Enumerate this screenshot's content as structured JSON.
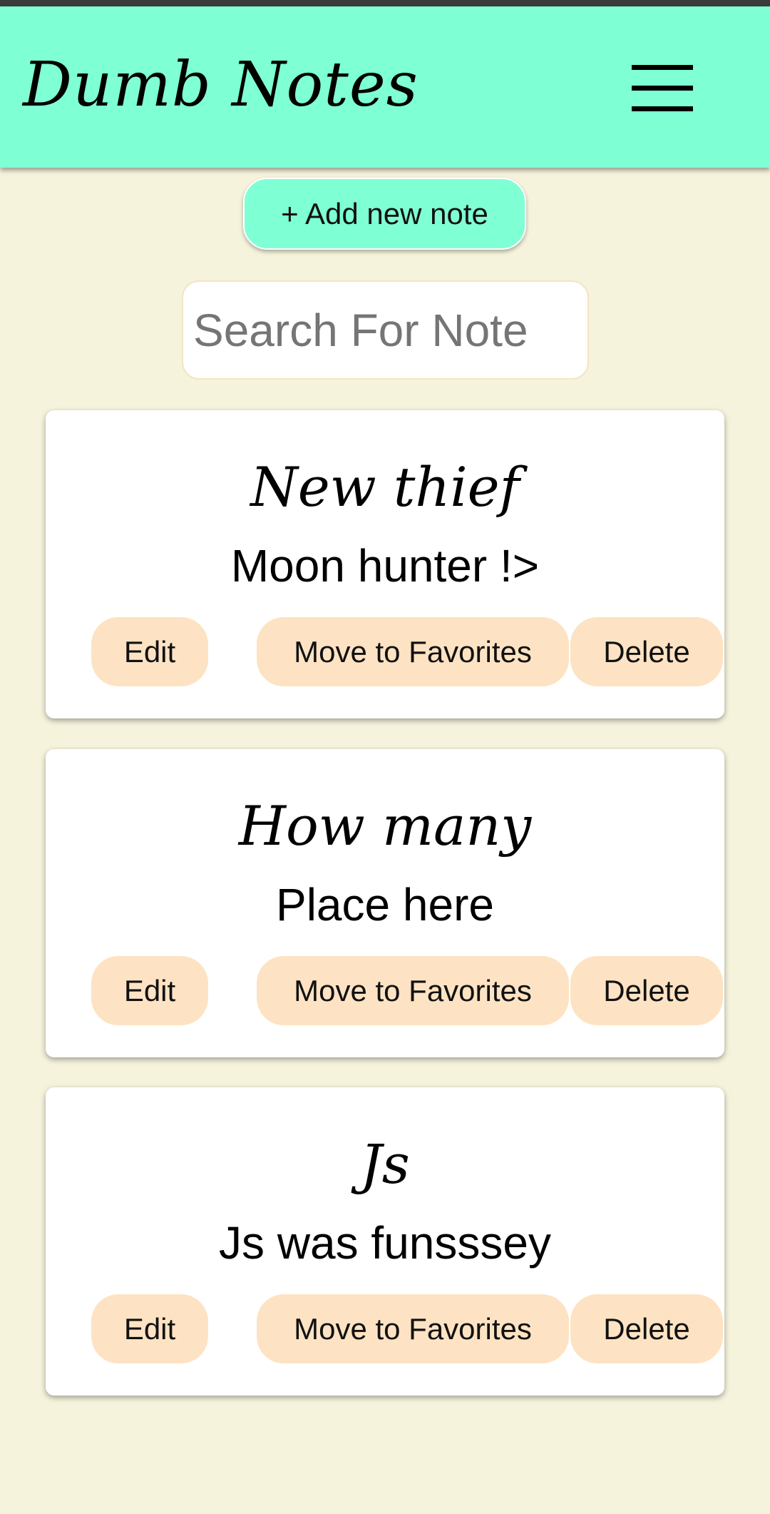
{
  "app": {
    "title": "Dumb Notes",
    "header_color": "#7fffd4",
    "background_color": "#f5f3dc",
    "button_color": "#fde3c3",
    "menu_icon": "hamburger-menu-icon"
  },
  "toolbar": {
    "add_note_label": "+ Add new note"
  },
  "search": {
    "placeholder": "Search For Note",
    "value": ""
  },
  "notes": [
    {
      "title": "New thief",
      "body": "Moon hunter !>",
      "edit_label": "Edit",
      "favorite_label": "Move to Favorites",
      "delete_label": "Delete"
    },
    {
      "title": "How many",
      "body": "Place here",
      "edit_label": "Edit",
      "favorite_label": "Move to Favorites",
      "delete_label": "Delete"
    },
    {
      "title": "Js",
      "body": "Js was funsssey",
      "edit_label": "Edit",
      "favorite_label": "Move to Favorites",
      "delete_label": "Delete"
    }
  ]
}
